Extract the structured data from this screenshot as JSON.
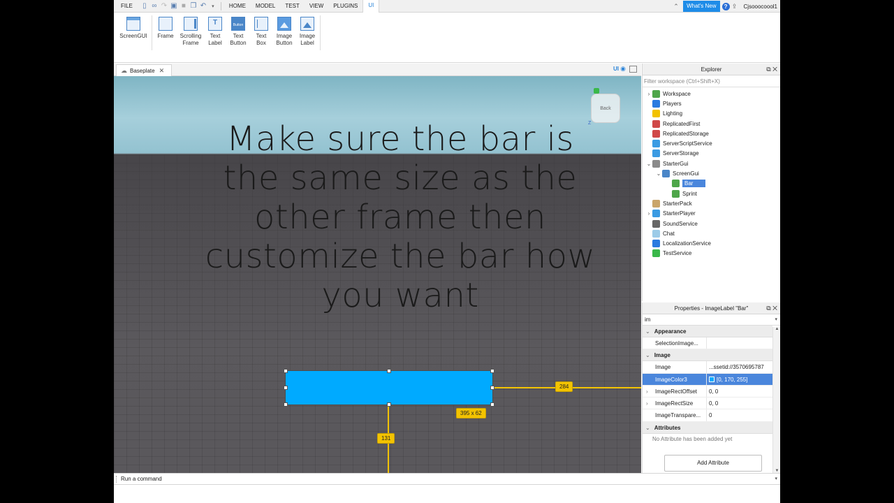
{
  "menubar": {
    "file": "FILE",
    "tabs": [
      "HOME",
      "MODEL",
      "TEST",
      "VIEW",
      "PLUGINS",
      "UI"
    ],
    "active_tab": "UI",
    "whats_new": "What's New",
    "username": "Cjsooocoool1"
  },
  "ribbon": {
    "buttons": [
      {
        "l1": "ScreenGUI",
        "l2": ""
      },
      {
        "l1": "Frame",
        "l2": ""
      },
      {
        "l1": "Scrolling",
        "l2": "Frame"
      },
      {
        "l1": "Text",
        "l2": "Label"
      },
      {
        "l1": "Text",
        "l2": "Button"
      },
      {
        "l1": "Text",
        "l2": "Box"
      },
      {
        "l1": "Image",
        "l2": "Button"
      },
      {
        "l1": "Image",
        "l2": "Label"
      }
    ]
  },
  "document": {
    "tab_title": "Baseplate",
    "ui_toggle": "UI"
  },
  "viewport": {
    "overlay_lines": [
      "Make sure the bar is",
      "the same size as the",
      "other frame then",
      "customize the bar how",
      "you want"
    ],
    "size_badge": "395 x 62",
    "right_offset_badge": "284",
    "bottom_offset_badge": "131",
    "bar_color": "#00aaff",
    "guide_color": "#f3c300",
    "view_cube_label": "Back",
    "axis_label": "Z"
  },
  "explorer": {
    "title": "Explorer",
    "filter_placeholder": "Filter workspace (Ctrl+Shift+X)",
    "items": [
      {
        "label": "Workspace",
        "expand": "›",
        "color": "#4ea64a"
      },
      {
        "label": "Players",
        "expand": "",
        "color": "#2a7be0"
      },
      {
        "label": "Lighting",
        "expand": "",
        "color": "#f2c200"
      },
      {
        "label": "ReplicatedFirst",
        "expand": "",
        "color": "#d04848"
      },
      {
        "label": "ReplicatedStorage",
        "expand": "",
        "color": "#d04848"
      },
      {
        "label": "ServerScriptService",
        "expand": "",
        "color": "#3b9be3"
      },
      {
        "label": "ServerStorage",
        "expand": "",
        "color": "#3b9be3"
      },
      {
        "label": "StarterGui",
        "expand": "⌄",
        "color": "#8a8a8a"
      },
      {
        "label": "ScreenGui",
        "expand": "⌄",
        "color": "#4a86c8"
      },
      {
        "label": "Bar",
        "expand": "",
        "color": "#4ea64a"
      },
      {
        "label": "Sprint",
        "expand": "",
        "color": "#4ea64a"
      },
      {
        "label": "StarterPack",
        "expand": "",
        "color": "#c9a56a"
      },
      {
        "label": "StarterPlayer",
        "expand": "›",
        "color": "#3b9be3"
      },
      {
        "label": "SoundService",
        "expand": "",
        "color": "#666666"
      },
      {
        "label": "Chat",
        "expand": "",
        "color": "#9ccbe8"
      },
      {
        "label": "LocalizationService",
        "expand": "",
        "color": "#2a7be0"
      },
      {
        "label": "TestService",
        "expand": "",
        "color": "#3ab84a"
      }
    ],
    "selected": "Bar"
  },
  "properties": {
    "title": "Properties - ImageLabel \"Bar\"",
    "search_value": "im",
    "sections": {
      "appearance": "Appearance",
      "image": "Image",
      "attributes": "Attributes"
    },
    "rows": {
      "selection_image": {
        "name": "SelectionImage...",
        "value": ""
      },
      "image": {
        "name": "Image",
        "value": "...ssetid://3570695787"
      },
      "image_color3": {
        "name": "ImageColor3",
        "value": "[0, 170, 255]"
      },
      "image_rect_offset": {
        "name": "ImageRectOffset",
        "value": "0, 0"
      },
      "image_rect_size": {
        "name": "ImageRectSize",
        "value": "0, 0"
      },
      "image_transparency": {
        "name": "ImageTranspare...",
        "value": "0"
      }
    },
    "no_attributes": "No Attribute has been added yet",
    "add_attribute": "Add Attribute"
  },
  "command_bar": {
    "placeholder": "Run a command"
  }
}
